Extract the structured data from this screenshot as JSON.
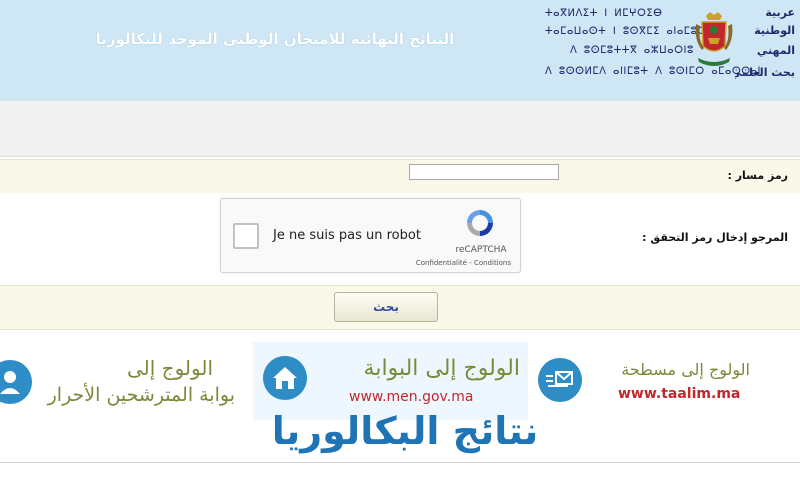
{
  "header": {
    "title": "النتائج النهائية للامتحان الوطني الموحد للبكالوريا",
    "tifinagh_lines": [
      "ⵜⴰⴳⵍⴷⵉⵜ ⵏ ⵍⵎⵖⵔⵉⴱ",
      "ⵜⴰⵎⴰⵡⴰⵙⵜ ⵏ ⵓⵙⴳⵎⵉ ⴰⵏⴰⵎⵓⵔ",
      "ⴷ ⵓⵙⵎⵓⵜⵜⴳ ⴰⵣⵡⴰⵔⵏⵓ",
      "ⴷ ⵓⵙⵙⵍⵎⴷ ⴰⵏⵏⵎⵓⵜ ⴷ ⵓⵙⵏⵎⵔ ⴰⵎⴰⵙⵙⴰⵏ"
    ],
    "arabic_side_lines": [
      "عربية",
      "الوطنية",
      "المهني",
      "بحث العلمي"
    ],
    "emblem_icon": "morocco-coat-of-arms-icon"
  },
  "form": {
    "massar_label": "رمز مسار :",
    "massar_value": "",
    "captcha_label": "المرجو إدخال رمز التحقق :",
    "search_button": "بحث"
  },
  "recaptcha": {
    "label": "Je ne suis pas un robot",
    "brand": "reCAPTCHA",
    "links": "Confidentialité - Conditions"
  },
  "banners": {
    "candidates": {
      "line1": "الولوج إلى",
      "line2": "بوابة المترشحين الأحرار",
      "icon": "users-icon"
    },
    "portal": {
      "line1": "الولوج إلى البوابة",
      "url": "www.men.gov.ma",
      "icon": "home-icon"
    },
    "taalim": {
      "line1": "الولوج إلى مسطحة",
      "url": "www.taalim.ma",
      "icon": "mail-icon"
    }
  },
  "big_title": "نتائج البكالوريا",
  "colors": {
    "header_bg": "#cfe6f5",
    "accent_blue": "#1f74b5",
    "form_row_bg": "#f9f8e9",
    "banner_text": "#7a8a3a",
    "url_red": "#c0282d"
  }
}
